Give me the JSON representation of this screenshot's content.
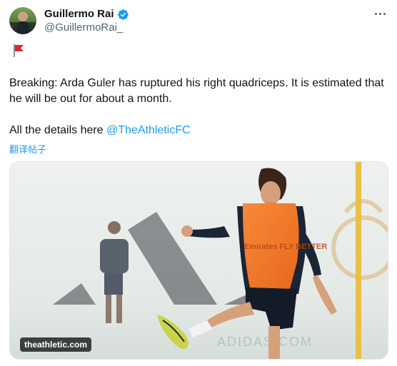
{
  "author": {
    "display_name": "Guillermo Rai",
    "handle": "@GuillermoRai_",
    "verified_icon": "verified-badge-icon"
  },
  "post": {
    "flag_emoji_name": "red-flag-icon",
    "paragraph_1": "Breaking: Arda Guler has ruptured his right quadriceps. It is estimated that he will be out for about a month.",
    "paragraph_2_prefix": "All the details here ",
    "paragraph_2_mention": "@TheAthleticFC",
    "translate_label": "翻译帖子"
  },
  "media": {
    "source_badge": "theathletic.com",
    "background_text": "ADIDAS.COM",
    "shirt_text": "Emirates FLY BETTER"
  },
  "colors": {
    "accent": "#1d9bf0",
    "text_primary": "#0f1419",
    "text_secondary": "#536471",
    "bib_orange": "#f47a24"
  }
}
